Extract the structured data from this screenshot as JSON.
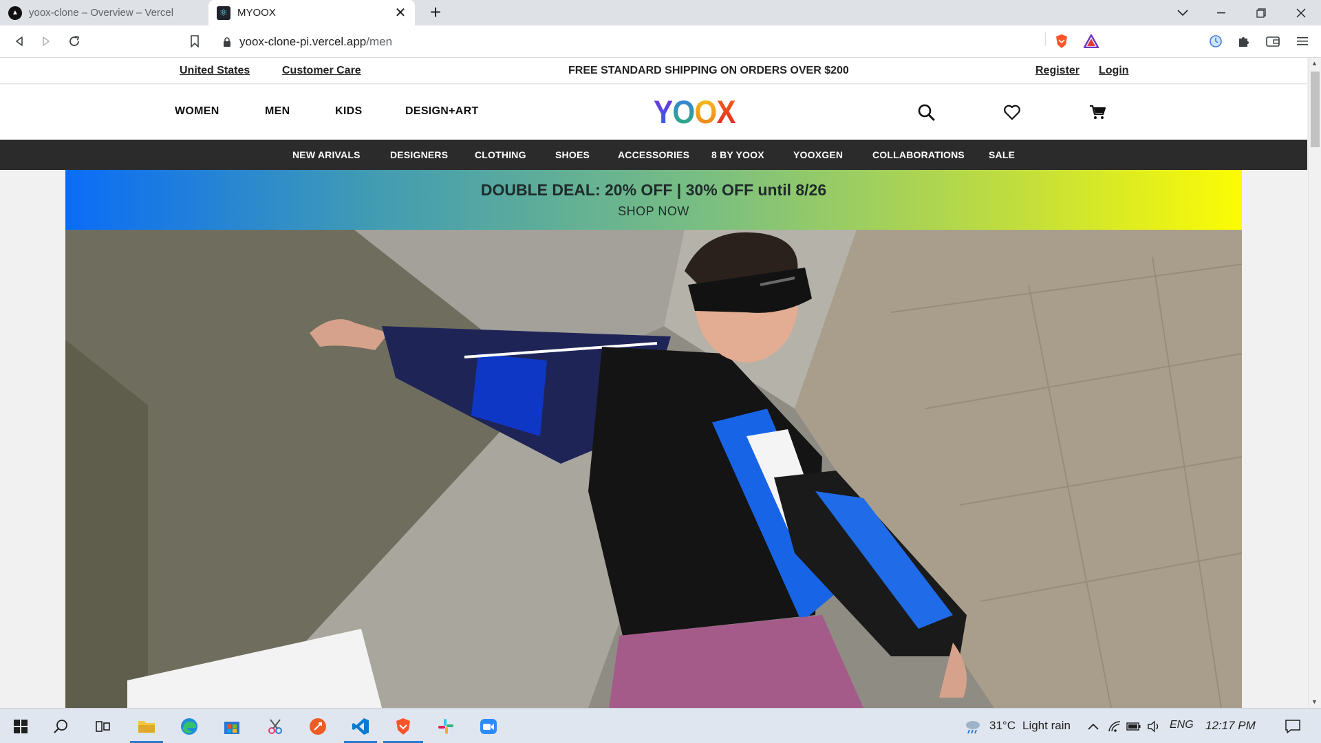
{
  "browser": {
    "tabs": [
      {
        "title": "yoox-clone – Overview – Vercel",
        "active": false
      },
      {
        "title": "MYOOX",
        "active": true
      }
    ],
    "url_host": "yoox-clone-pi.vercel.app",
    "url_path": "/men"
  },
  "site": {
    "topbar": {
      "country": "United States",
      "customer_care": "Customer Care",
      "shipping_note": "FREE STANDARD SHIPPING ON ORDERS OVER $200",
      "register": "Register",
      "login": "Login"
    },
    "main_nav": [
      "WOMEN",
      "MEN",
      "KIDS",
      "DESIGN+ART"
    ],
    "logo_letters": [
      "Y",
      "O",
      "O",
      "X"
    ],
    "categories": [
      "NEW ARIVALS",
      "DESIGNERS",
      "CLOTHING",
      "SHOES",
      "ACCESSORIES",
      "8 BY YOOX",
      "YOOXGEN",
      "COLLABORATIONS",
      "SALE"
    ],
    "promo": {
      "title": "DOUBLE DEAL: 20% OFF | 30% OFF until 8/26",
      "cta": "SHOP NOW"
    },
    "colors": {
      "category_bar": "#2b2b2b",
      "promo_start": "#0a6cf7",
      "promo_end": "#fcfc03"
    }
  },
  "taskbar": {
    "weather_temp": "31°C",
    "weather_desc": "Light rain",
    "language": "ENG",
    "time": "12:17 PM"
  }
}
